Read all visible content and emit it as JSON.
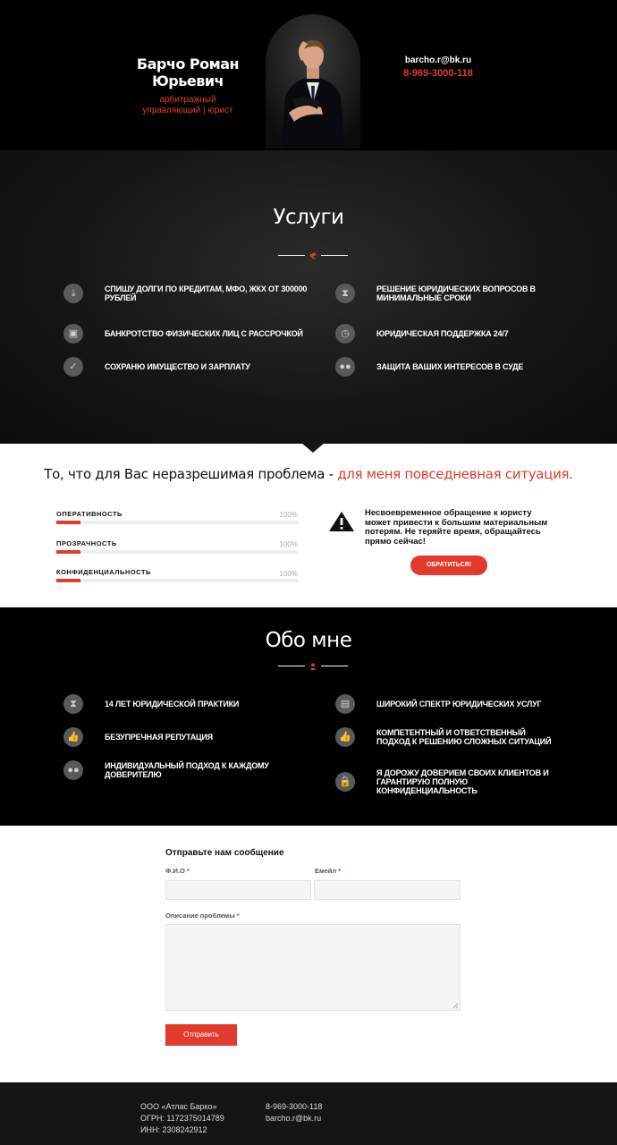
{
  "header": {
    "name": "Барчо Роман Юрьевич",
    "role": "арбитражный управляющий | юрист",
    "email": "barcho.r@bk.ru",
    "phone": "8-969-3000-118"
  },
  "services": {
    "title": "Услуги",
    "items": [
      {
        "icon": "download-icon",
        "label": "Спишу долги по кредитам, МФО, ЖКХ от 300000 рублей"
      },
      {
        "icon": "hourglass-icon",
        "label": "Решение юридических вопросов в минимальные сроки"
      },
      {
        "icon": "car-icon",
        "label": "Банкротство физических лиц с рассрочкой"
      },
      {
        "icon": "clock-icon",
        "label": "Юридическая поддержка 24/7"
      },
      {
        "icon": "check-icon",
        "label": "Сохраню имущество и зарплату"
      },
      {
        "icon": "users-icon",
        "label": "Защита ваших интересов в суде"
      }
    ]
  },
  "tagline": {
    "black": "То, что для Вас неразрешимая проблема - ",
    "red": "для меня повседневная ситуация."
  },
  "skills": [
    {
      "label": "ОПЕРАТИВНОСТЬ",
      "percent": "100%",
      "fill": 0.1
    },
    {
      "label": "ПРОЗРАЧНОСТЬ",
      "percent": "100%",
      "fill": 0.1
    },
    {
      "label": "КОНФИДЕНЦИАЛЬНОСТЬ",
      "percent": "100%",
      "fill": 0.1
    }
  ],
  "warning": {
    "text": "Несвоевременное обращение к юристу может привести к большим материальным потерям. Не теряйте время, обращайтесь прямо сейчас!",
    "button": "ОБРАТИТЬСЯ!"
  },
  "about": {
    "title": "Обо мне",
    "items": [
      {
        "icon": "hourglass-icon",
        "label": "14 лет юридической практики"
      },
      {
        "icon": "document-icon",
        "label": "Широкий спектр юридических услуг"
      },
      {
        "icon": "thumbs-up-icon",
        "label": "Безупречная репутация"
      },
      {
        "icon": "thumbs-up-icon",
        "label": "Компетентный и ответственный подход к решению сложных ситуаций"
      },
      {
        "icon": "users-icon",
        "label": "Индивидуальный подход к каждому доверителю"
      },
      {
        "icon": "lock-icon",
        "label": "Я дорожу доверием своих клиентов и гарантирую полную конфиденциальность"
      }
    ]
  },
  "form": {
    "title": "Отправьте нам сообщение",
    "name_label": "Ф.И.О",
    "email_label": "Емейл",
    "problem_label": "Описание проблемы",
    "required_mark": "*",
    "submit": "Отправить"
  },
  "footer": {
    "company": "ООО «Атлас Барко»",
    "ogrn": "ОГРН: 1172375014789",
    "inn": "ИНН: 2308242912",
    "phone": "8-969-3000-118",
    "email": "barcho.r@bk.ru"
  },
  "colors": {
    "accent": "#e23b2e",
    "dark": "#000000",
    "light": "#ffffff"
  }
}
